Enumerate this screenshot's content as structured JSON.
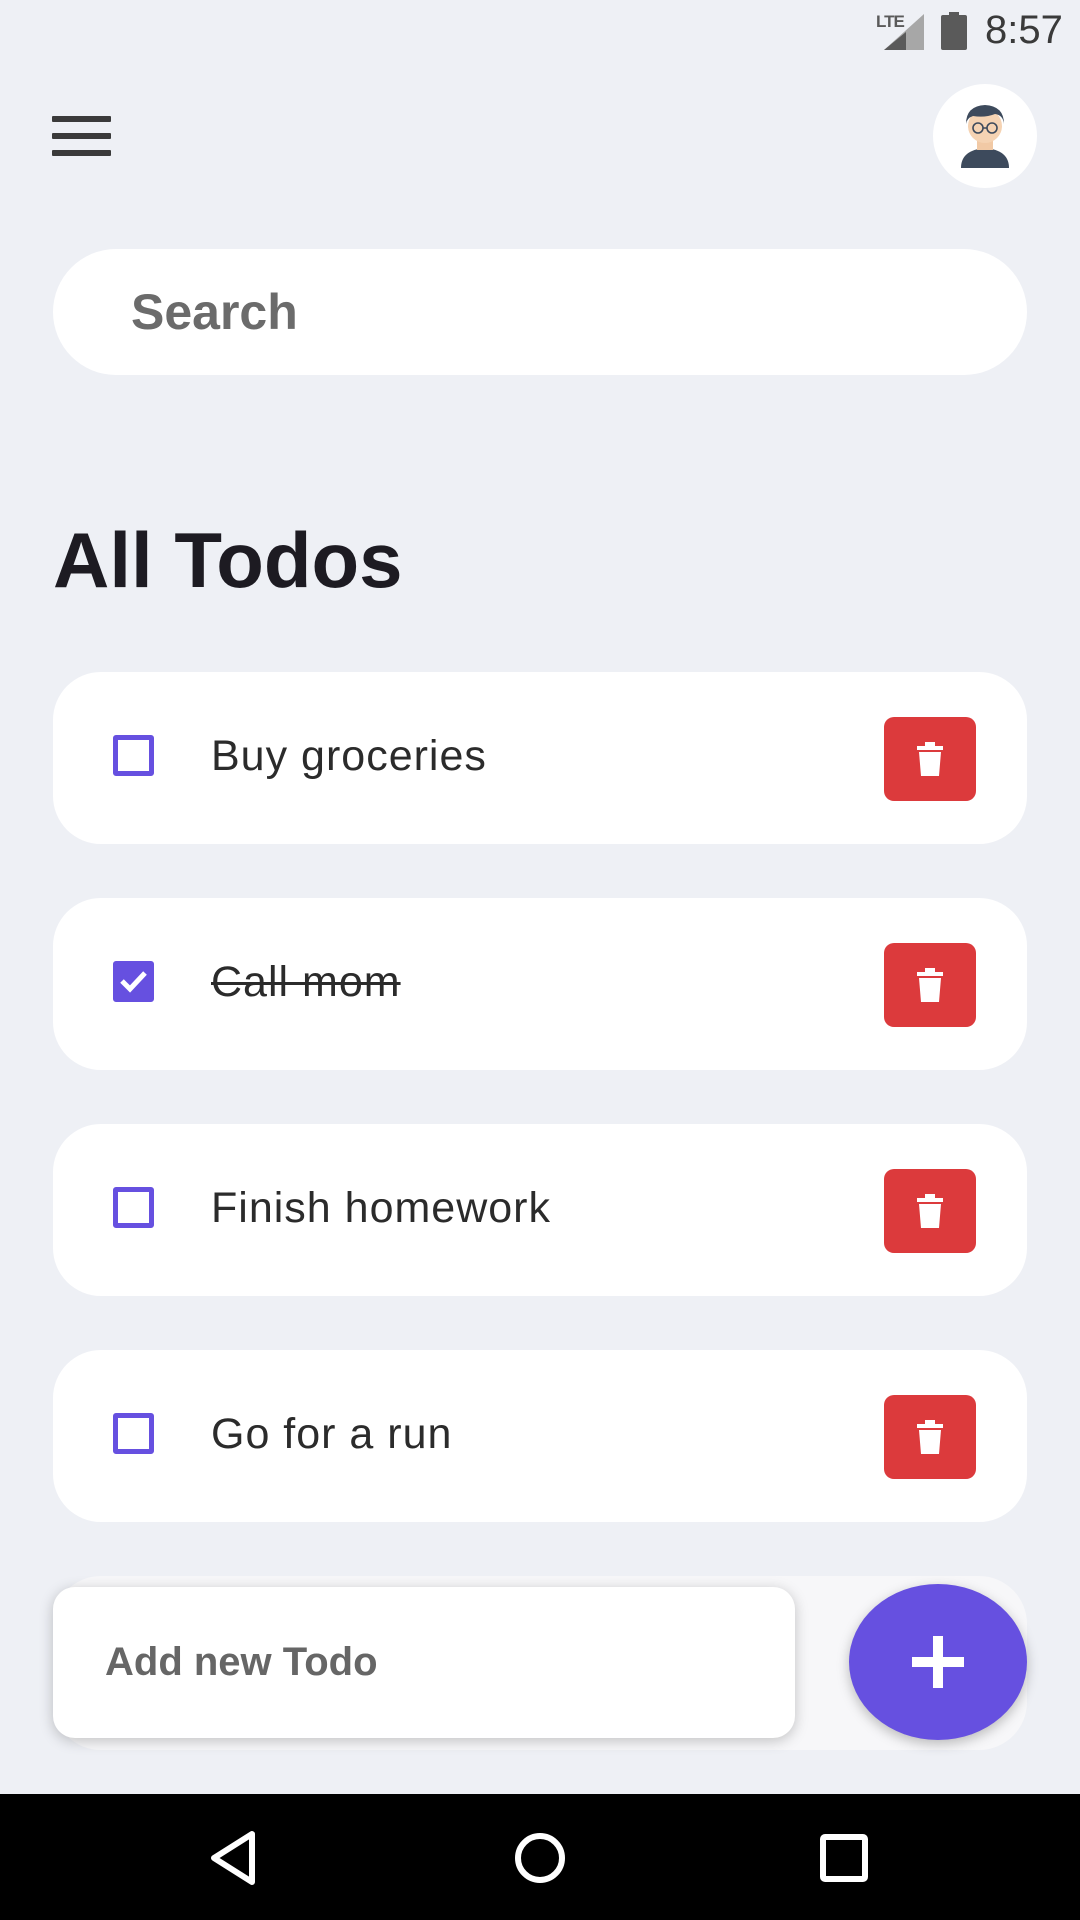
{
  "status_bar": {
    "network": "LTE",
    "time": "8:57"
  },
  "header": {
    "menu_icon": "hamburger-menu-icon",
    "avatar_icon": "user-avatar-icon"
  },
  "search": {
    "placeholder": "Search",
    "value": ""
  },
  "page": {
    "title": "All Todos"
  },
  "todos": [
    {
      "text": "Buy groceries",
      "done": false
    },
    {
      "text": "Call mom",
      "done": true
    },
    {
      "text": "Finish homework",
      "done": false
    },
    {
      "text": "Go for a run",
      "done": false
    }
  ],
  "add_todo": {
    "placeholder": "Add new Todo",
    "value": "",
    "button_icon": "plus-icon"
  },
  "navigation": {
    "back_icon": "back-triangle-icon",
    "home_icon": "home-circle-icon",
    "recents_icon": "recents-square-icon"
  },
  "colors": {
    "accent": "#6650e0",
    "delete": "#dc3a3c",
    "background": "#eef0f5",
    "card": "#ffffff"
  }
}
